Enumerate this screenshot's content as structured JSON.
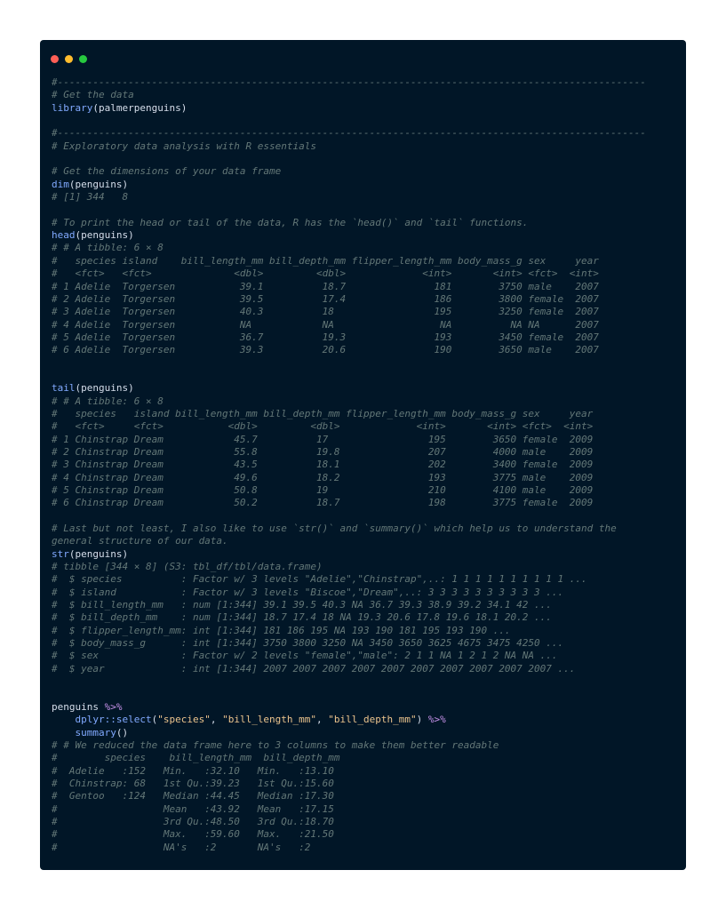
{
  "window": {
    "controls": [
      "close",
      "minimize",
      "maximize"
    ],
    "colors": {
      "background": "#011627",
      "close": "#ff5f56",
      "minimize": "#ffbd2e",
      "maximize": "#27c93f"
    }
  },
  "code_lines": [
    [
      {
        "t": "c",
        "v": "#----------------------------------------------------------------------------------------------------"
      }
    ],
    [
      {
        "t": "c",
        "v": "# Get the data"
      }
    ],
    [
      {
        "t": "f",
        "v": "library"
      },
      {
        "t": "p",
        "v": "(palmerpenguins)"
      }
    ],
    [],
    [
      {
        "t": "c",
        "v": "#----------------------------------------------------------------------------------------------------"
      }
    ],
    [
      {
        "t": "c",
        "v": "# Exploratory data analysis with R essentials"
      }
    ],
    [],
    [
      {
        "t": "c",
        "v": "# Get the dimensions of your data frame"
      }
    ],
    [
      {
        "t": "f",
        "v": "dim"
      },
      {
        "t": "p",
        "v": "(penguins)"
      }
    ],
    [
      {
        "t": "c",
        "v": "# [1] 344   8"
      }
    ],
    [],
    [
      {
        "t": "c",
        "v": "# To print the head or tail of the data, R has the `head()` and `tail` functions."
      }
    ],
    [
      {
        "t": "f",
        "v": "head"
      },
      {
        "t": "p",
        "v": "(penguins)"
      }
    ],
    [
      {
        "t": "c",
        "v": "# # A tibble: 6 × 8"
      }
    ],
    [
      {
        "t": "c",
        "v": "#   species island    bill_length_mm bill_depth_mm flipper_length_mm body_mass_g sex     year"
      }
    ],
    [
      {
        "t": "c",
        "v": "#   <fct>   <fct>              <dbl>         <dbl>             <int>       <int> <fct>  <int>"
      }
    ],
    [
      {
        "t": "c",
        "v": "# 1 Adelie  Torgersen           39.1          18.7               181        3750 male    2007"
      }
    ],
    [
      {
        "t": "c",
        "v": "# 2 Adelie  Torgersen           39.5          17.4               186        3800 female  2007"
      }
    ],
    [
      {
        "t": "c",
        "v": "# 3 Adelie  Torgersen           40.3          18                 195        3250 female  2007"
      }
    ],
    [
      {
        "t": "c",
        "v": "# 4 Adelie  Torgersen           NA            NA                  NA          NA NA      2007"
      }
    ],
    [
      {
        "t": "c",
        "v": "# 5 Adelie  Torgersen           36.7          19.3               193        3450 female  2007"
      }
    ],
    [
      {
        "t": "c",
        "v": "# 6 Adelie  Torgersen           39.3          20.6               190        3650 male    2007"
      }
    ],
    [],
    [],
    [
      {
        "t": "f",
        "v": "tail"
      },
      {
        "t": "p",
        "v": "(penguins)"
      }
    ],
    [
      {
        "t": "c",
        "v": "# # A tibble: 6 × 8"
      }
    ],
    [
      {
        "t": "c",
        "v": "#   species   island bill_length_mm bill_depth_mm flipper_length_mm body_mass_g sex     year"
      }
    ],
    [
      {
        "t": "c",
        "v": "#   <fct>     <fct>           <dbl>         <dbl>             <int>       <int> <fct>  <int>"
      }
    ],
    [
      {
        "t": "c",
        "v": "# 1 Chinstrap Dream            45.7          17                 195        3650 female  2009"
      }
    ],
    [
      {
        "t": "c",
        "v": "# 2 Chinstrap Dream            55.8          19.8               207        4000 male    2009"
      }
    ],
    [
      {
        "t": "c",
        "v": "# 3 Chinstrap Dream            43.5          18.1               202        3400 female  2009"
      }
    ],
    [
      {
        "t": "c",
        "v": "# 4 Chinstrap Dream            49.6          18.2               193        3775 male    2009"
      }
    ],
    [
      {
        "t": "c",
        "v": "# 5 Chinstrap Dream            50.8          19                 210        4100 male    2009"
      }
    ],
    [
      {
        "t": "c",
        "v": "# 6 Chinstrap Dream            50.2          18.7               198        3775 female  2009"
      }
    ],
    [],
    [
      {
        "t": "c",
        "v": "# Last but not least, I also like to use `str()` and `summary()` which help us to understand the"
      }
    ],
    [
      {
        "t": "c",
        "v": "general structure of our data."
      }
    ],
    [
      {
        "t": "f",
        "v": "str"
      },
      {
        "t": "p",
        "v": "(penguins)"
      }
    ],
    [
      {
        "t": "c",
        "v": "# tibble [344 × 8] (S3: tbl_df/tbl/data.frame)"
      }
    ],
    [
      {
        "t": "c",
        "v": "#  $ species          : Factor w/ 3 levels \"Adelie\",\"Chinstrap\",..: 1 1 1 1 1 1 1 1 1 1 ..."
      }
    ],
    [
      {
        "t": "c",
        "v": "#  $ island           : Factor w/ 3 levels \"Biscoe\",\"Dream\",..: 3 3 3 3 3 3 3 3 3 3 ..."
      }
    ],
    [
      {
        "t": "c",
        "v": "#  $ bill_length_mm   : num [1:344] 39.1 39.5 40.3 NA 36.7 39.3 38.9 39.2 34.1 42 ..."
      }
    ],
    [
      {
        "t": "c",
        "v": "#  $ bill_depth_mm    : num [1:344] 18.7 17.4 18 NA 19.3 20.6 17.8 19.6 18.1 20.2 ..."
      }
    ],
    [
      {
        "t": "c",
        "v": "#  $ flipper_length_mm: int [1:344] 181 186 195 NA 193 190 181 195 193 190 ..."
      }
    ],
    [
      {
        "t": "c",
        "v": "#  $ body_mass_g      : int [1:344] 3750 3800 3250 NA 3450 3650 3625 4675 3475 4250 ..."
      }
    ],
    [
      {
        "t": "c",
        "v": "#  $ sex              : Factor w/ 2 levels \"female\",\"male\": 2 1 1 NA 1 2 1 2 NA NA ..."
      }
    ],
    [
      {
        "t": "c",
        "v": "#  $ year             : int [1:344] 2007 2007 2007 2007 2007 2007 2007 2007 2007 2007 ..."
      }
    ],
    [],
    [],
    [
      {
        "t": "p",
        "v": "penguins "
      },
      {
        "t": "o",
        "v": "%>%"
      }
    ],
    [
      {
        "t": "p",
        "v": "    "
      },
      {
        "t": "f",
        "v": "dplyr::select"
      },
      {
        "t": "p",
        "v": "("
      },
      {
        "t": "s",
        "v": "\"species\""
      },
      {
        "t": "p",
        "v": ", "
      },
      {
        "t": "s",
        "v": "\"bill_length_mm\""
      },
      {
        "t": "p",
        "v": ", "
      },
      {
        "t": "s",
        "v": "\"bill_depth_mm\""
      },
      {
        "t": "p",
        "v": ") "
      },
      {
        "t": "o",
        "v": "%>%"
      }
    ],
    [
      {
        "t": "p",
        "v": "    "
      },
      {
        "t": "f",
        "v": "summary"
      },
      {
        "t": "p",
        "v": "()"
      }
    ],
    [
      {
        "t": "c",
        "v": "# # We reduced the data frame here to 3 columns to make them better readable"
      }
    ],
    [
      {
        "t": "c",
        "v": "#        species    bill_length_mm  bill_depth_mm"
      }
    ],
    [
      {
        "t": "c",
        "v": "#  Adelie   :152   Min.   :32.10   Min.   :13.10"
      }
    ],
    [
      {
        "t": "c",
        "v": "#  Chinstrap: 68   1st Qu.:39.23   1st Qu.:15.60"
      }
    ],
    [
      {
        "t": "c",
        "v": "#  Gentoo   :124   Median :44.45   Median :17.30"
      }
    ],
    [
      {
        "t": "c",
        "v": "#                  Mean   :43.92   Mean   :17.15"
      }
    ],
    [
      {
        "t": "c",
        "v": "#                  3rd Qu.:48.50   3rd Qu.:18.70"
      }
    ],
    [
      {
        "t": "c",
        "v": "#                  Max.   :59.60   Max.   :21.50"
      }
    ],
    [
      {
        "t": "c",
        "v": "#                  NA's   :2       NA's   :2"
      }
    ]
  ]
}
